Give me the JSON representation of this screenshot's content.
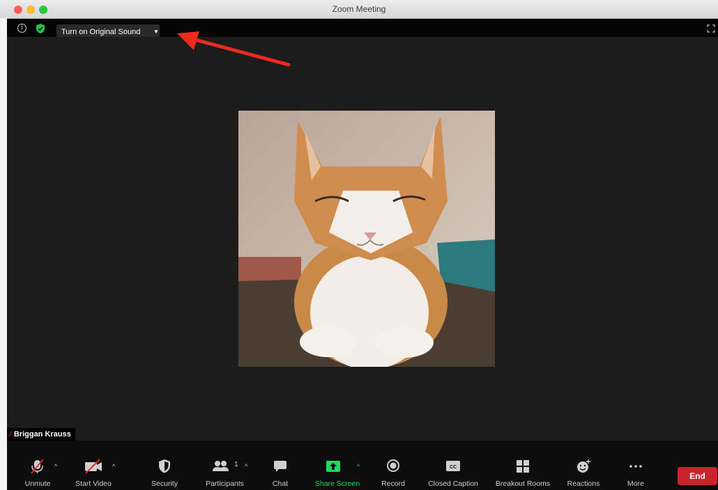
{
  "window": {
    "title": "Zoom Meeting"
  },
  "topbar": {
    "original_sound_label": "Turn on Original Sound"
  },
  "video": {
    "participant_name": "Briggan Krauss"
  },
  "toolbar": {
    "unmute_label": "Unmute",
    "start_video_label": "Start Video",
    "security_label": "Security",
    "participants_label": "Participants",
    "participants_count": "1",
    "chat_label": "Chat",
    "share_screen_label": "Share Screen",
    "record_label": "Record",
    "closed_caption_label": "Closed Caption",
    "breakout_rooms_label": "Breakout Rooms",
    "reactions_label": "Reactions",
    "more_label": "More",
    "end_label": "End"
  },
  "icons": [
    "info-icon",
    "shield-check-icon",
    "caret-down-icon",
    "fullscreen-icon",
    "microphone-muted-icon",
    "video-off-icon",
    "security-shield-icon",
    "participants-icon",
    "chat-icon",
    "share-screen-icon",
    "record-icon",
    "closed-caption-icon",
    "breakout-rooms-icon",
    "reactions-icon",
    "more-icon"
  ],
  "colors": {
    "share_green": "#23d959",
    "end_red": "#c9242b",
    "annotation_arrow": "#ee2a1f",
    "security_green": "#23c552"
  }
}
